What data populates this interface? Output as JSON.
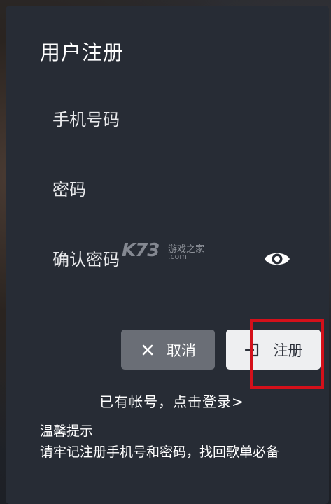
{
  "dialog": {
    "title": "用户注册"
  },
  "form": {
    "phone_placeholder": "手机号码",
    "password_placeholder": "密码",
    "confirm_placeholder": "确认密码"
  },
  "watermark": {
    "logo": "K73",
    "cn": "游戏之家",
    "domain": ".com"
  },
  "buttons": {
    "cancel_label": "取消",
    "cancel_icon": "close-icon",
    "register_label": "注册",
    "register_icon": "sign-in-icon"
  },
  "login_link": "已有帐号，点击登录>",
  "tips": {
    "title": "温馨提示",
    "body": "请牢记注册手机号和密码，找回歌单必备"
  },
  "colors": {
    "dialog_bg": "#272c35",
    "cancel_bg": "#6a6e76",
    "register_bg": "#eeeff1",
    "highlight": "#d4101a"
  }
}
